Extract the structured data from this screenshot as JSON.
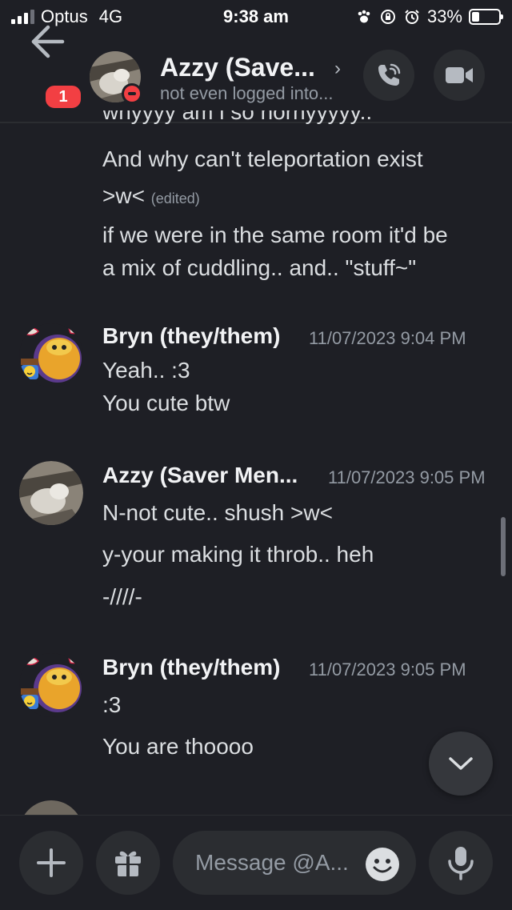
{
  "status_bar": {
    "carrier": "Optus",
    "network": "4G",
    "time": "9:38 am",
    "battery": "33%"
  },
  "header": {
    "unread_badge": "1",
    "name": "Azzy (Save...",
    "chevron": "›",
    "status": "not even logged into..."
  },
  "messages": {
    "clipped_line": "whyyyy am i so hornyyyyy..",
    "line1": "And why can't teleportation exist",
    "line2": ">w<",
    "edited": "(edited)",
    "line3": "if we were in the same room it'd be",
    "line4": "a mix of cuddling..  and.. \"stuff~\"",
    "group1": {
      "author": "Bryn (they/them)",
      "timestamp": "11/07/2023 9:04 PM",
      "line1": "Yeah.. :3",
      "line2": "You cute btw"
    },
    "group2": {
      "author": "Azzy (Saver Men...",
      "timestamp": "11/07/2023 9:05 PM",
      "line1": "N-not cute.. shush >w<",
      "line2": "y-your making it throb.. heh",
      "line3": "-////-"
    },
    "group3": {
      "author": "Bryn (they/them)",
      "timestamp": "11/07/2023 9:05 PM",
      "line1": ":3",
      "line2": "You are thoooo"
    }
  },
  "composer": {
    "placeholder": "Message @A..."
  },
  "colors": {
    "background": "#1e1f25",
    "surface": "#2b2d31",
    "badge_red": "#f23f43",
    "muted_text": "#949ba4"
  }
}
